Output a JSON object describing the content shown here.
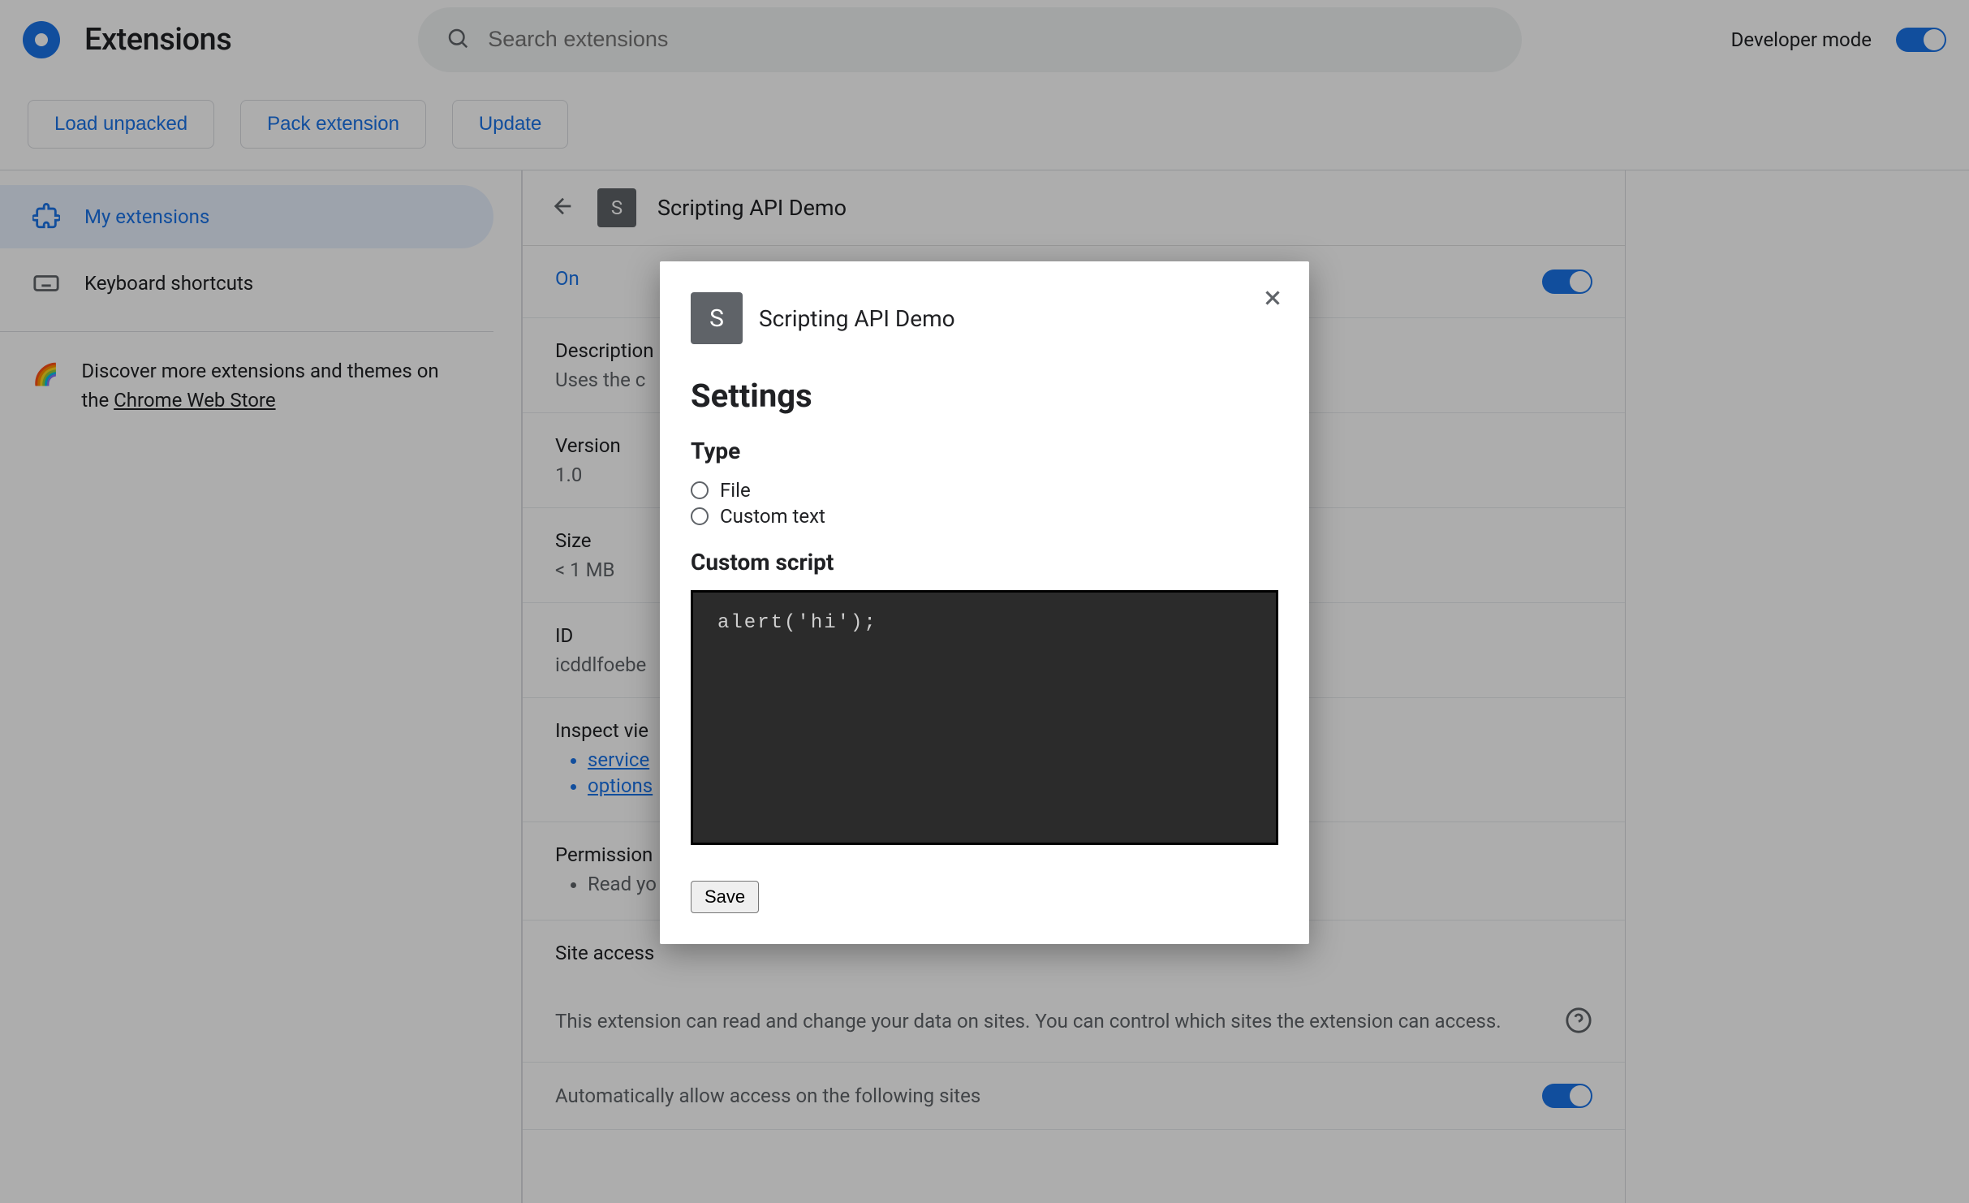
{
  "header": {
    "title": "Extensions",
    "search_placeholder": "Search extensions",
    "dev_mode_label": "Developer mode",
    "dev_mode_on": true
  },
  "actions": {
    "load_unpacked": "Load unpacked",
    "pack_extension": "Pack extension",
    "update": "Update"
  },
  "sidebar": {
    "my_extensions": "My extensions",
    "keyboard_shortcuts": "Keyboard shortcuts",
    "promo_prefix": "Discover more extensions and themes on the ",
    "promo_link": "Chrome Web Store"
  },
  "detail": {
    "name": "Scripting API Demo",
    "badge_letter": "S",
    "on_label": "On",
    "on_value": true,
    "description_label": "Description",
    "description_value": "Uses the c",
    "version_label": "Version",
    "version_value": "1.0",
    "size_label": "Size",
    "size_value": "< 1 MB",
    "id_label": "ID",
    "id_value": "icddlfoebe",
    "inspect_label": "Inspect vie",
    "inspect_items": [
      "service",
      "options"
    ],
    "permissions_label": "Permission",
    "permissions_items": [
      "Read yo"
    ],
    "site_access_label": "Site access",
    "site_access_text": "This extension can read and change your data on sites. You can control which sites the extension can access.",
    "auto_allow_label": "Automatically allow access on the following sites"
  },
  "dialog": {
    "ext_name": "Scripting API Demo",
    "badge_letter": "S",
    "settings_heading": "Settings",
    "type_heading": "Type",
    "radio_file": "File",
    "radio_custom": "Custom text",
    "custom_script_heading": "Custom script",
    "script_value": "alert('hi');",
    "save_label": "Save"
  }
}
